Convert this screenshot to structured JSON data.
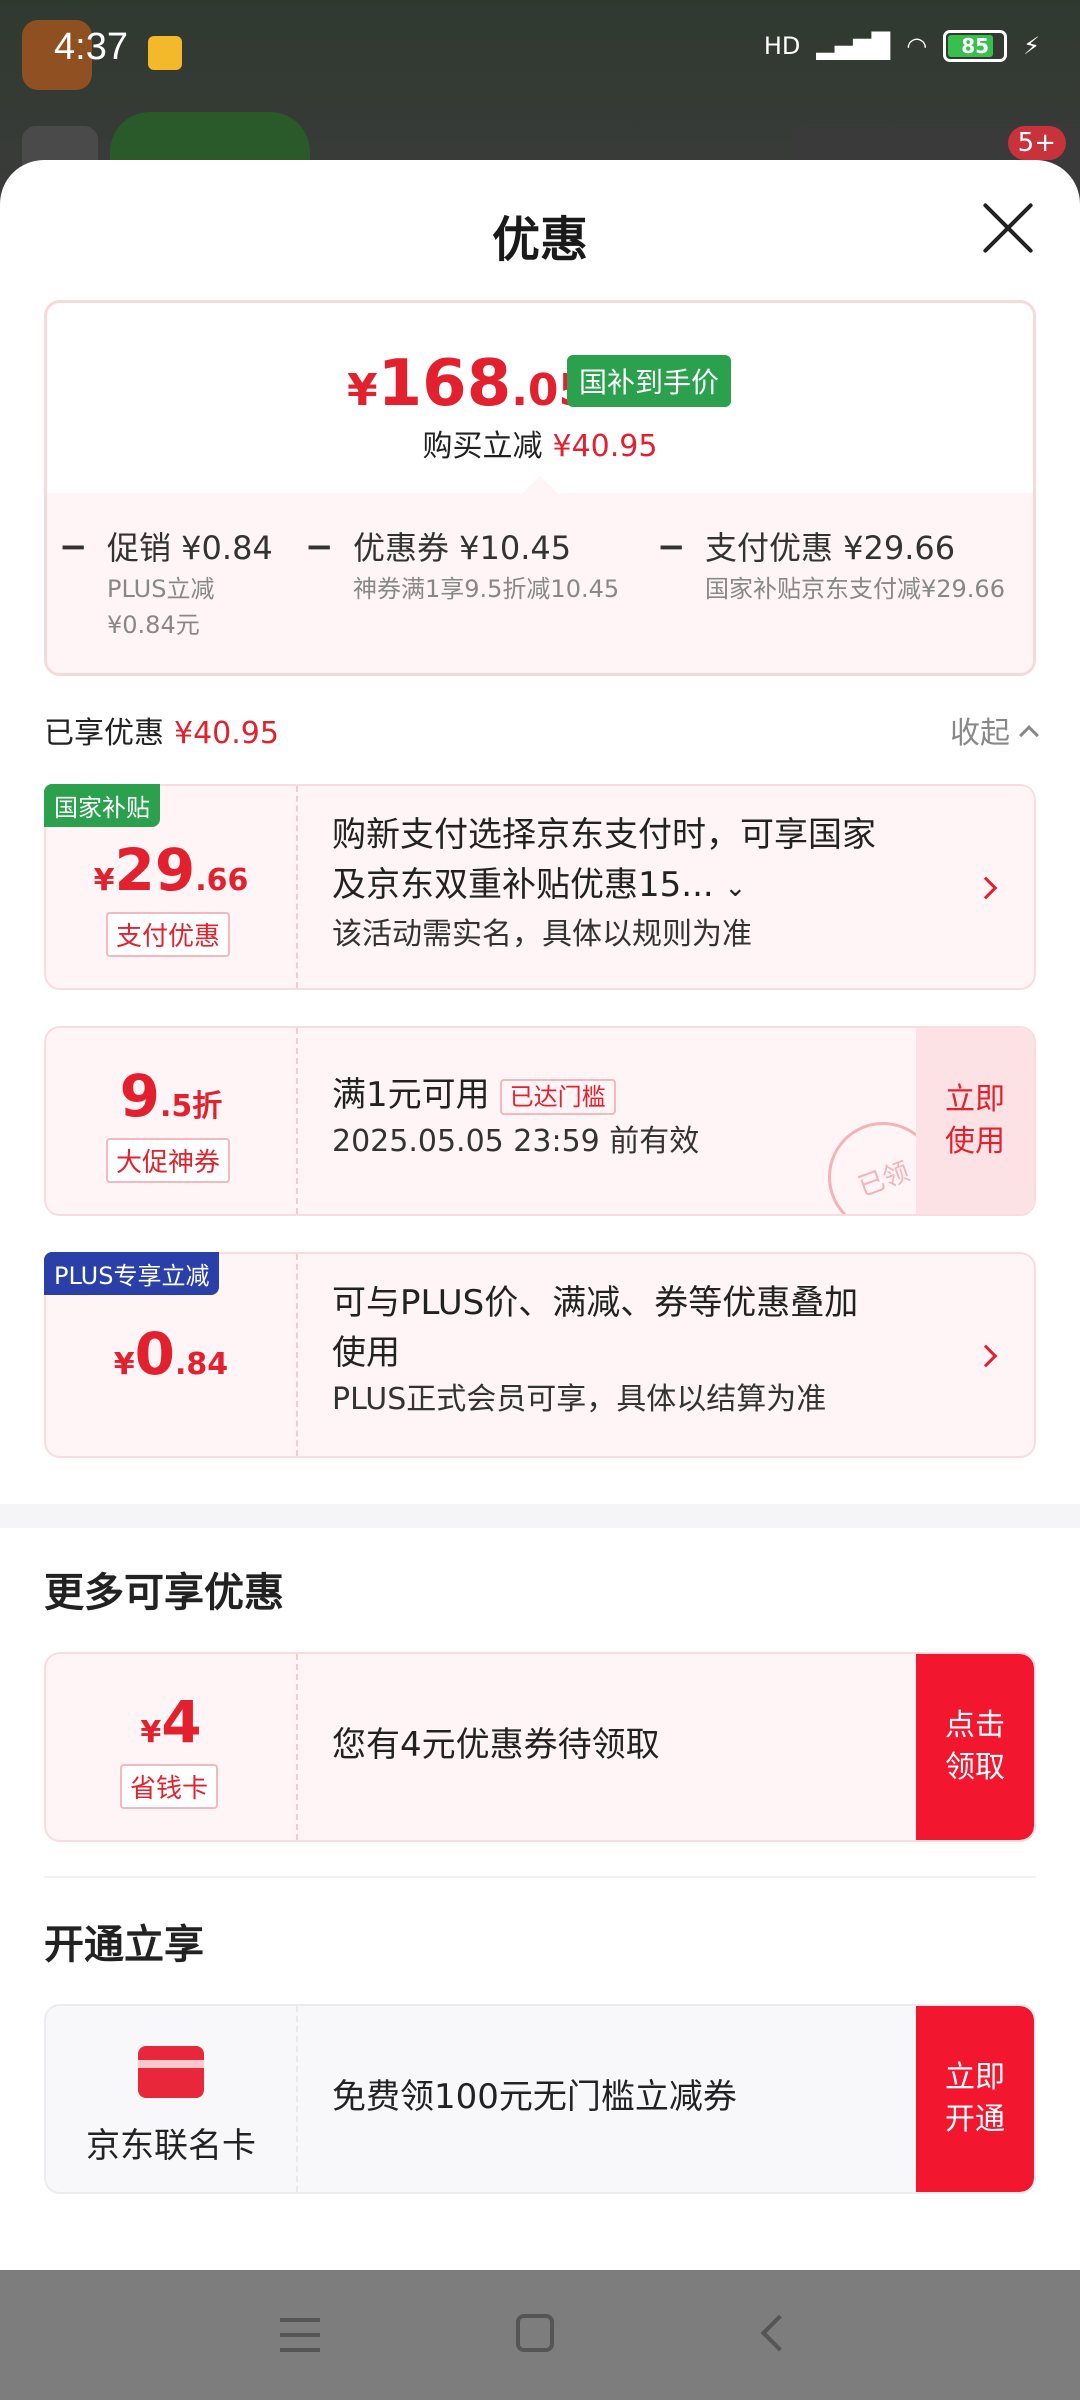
{
  "status_bar": {
    "time": "4:37",
    "network": "HD",
    "battery": "85",
    "battery_level": 0.85
  },
  "background": {
    "badge": "5+"
  },
  "sheet": {
    "title": "优惠"
  },
  "summary": {
    "currency": "¥",
    "price_int": "168",
    "price_dec": ".05",
    "tag": "国补到手价",
    "reduce_label": "购买立减",
    "reduce_amount": "¥40.95",
    "breakdown": [
      {
        "title": "促销 ¥0.84",
        "desc1": "PLUS立减",
        "desc2": "¥0.84元"
      },
      {
        "title": "优惠券 ¥10.45",
        "desc1": "神券满1享9.5折减10.45"
      },
      {
        "title": "支付优惠 ¥29.66",
        "desc1": "国家补贴京东支付减¥29.66"
      }
    ]
  },
  "enjoyed": {
    "label": "已享优惠",
    "amount": "¥40.95",
    "collapse": "收起"
  },
  "coupons": [
    {
      "corner_tag": "国家补贴",
      "value_prefix": "¥",
      "value_int": "29",
      "value_dec": ".66",
      "sub_tag": "支付优惠",
      "line1": "购新支付选择京东支付时，可享国家",
      "line1b": "及京东双重补贴优惠15...",
      "line2": "该活动需实名，具体以规则为准"
    },
    {
      "value_int": "9",
      "value_dec": ".5折",
      "sub_tag": "大促神券",
      "line1": "满1元可用",
      "inline_tag": "已达门槛",
      "line2": "2025.05.05 23:59 前有效",
      "action": "立即使用",
      "stamp": "已领"
    },
    {
      "corner_tag": "PLUS专享立减",
      "value_prefix": "¥",
      "value_int": "0",
      "value_dec": ".84",
      "line1": "可与PLUS价、满减、券等优惠叠加",
      "line1b": "使用",
      "line2": "PLUS正式会员可享，具体以结算为准"
    }
  ],
  "more": {
    "title": "更多可享优惠",
    "value_prefix": "¥",
    "value_int": "4",
    "sub_tag": "省钱卡",
    "text": "您有4元优惠券待领取",
    "action": "点击领取"
  },
  "open": {
    "title": "开通立享",
    "card_name": "京东联名卡",
    "text": "免费领100元无门槛立减券",
    "action": "立即开通"
  },
  "colors": {
    "accent": "#e3212e",
    "green_tag": "#2ba14d",
    "plus_tag": "#2a3fa8",
    "action_red": "#f2172f"
  }
}
